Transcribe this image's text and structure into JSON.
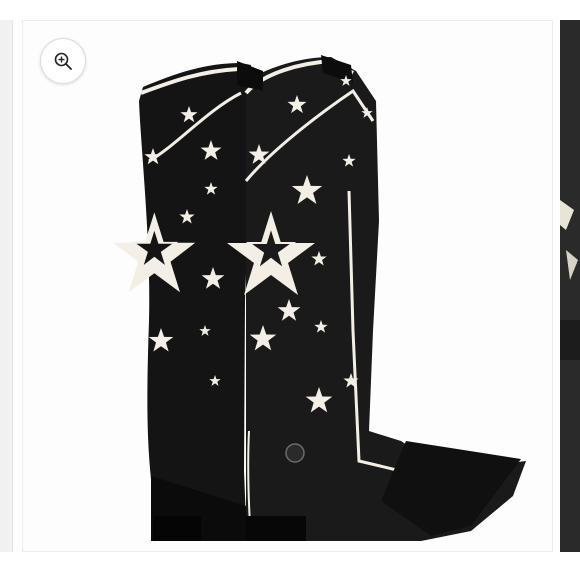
{
  "gallery": {
    "zoom_button": {
      "icon": "zoom-in-icon"
    },
    "main_image": {
      "subject": "boots-photo",
      "colors": {
        "leather": "#111111",
        "inlay": "#f3efe6",
        "background": "#fdfdfd"
      }
    },
    "next_thumbnail": {
      "icon": "partial-photo"
    }
  }
}
